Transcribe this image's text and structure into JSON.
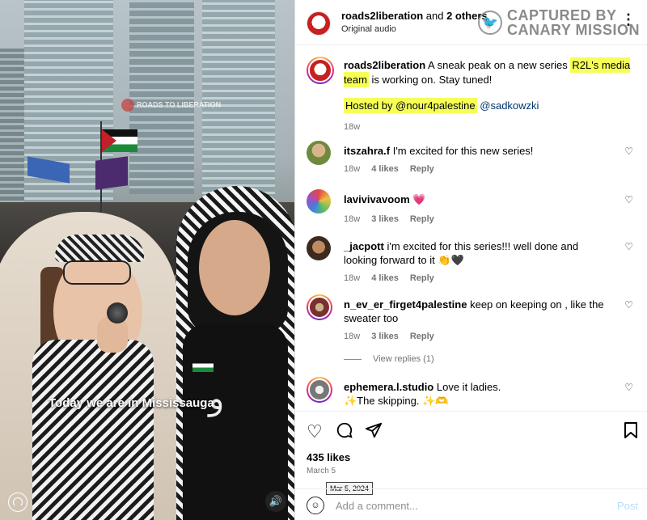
{
  "header": {
    "username": "roads2liberation",
    "and_text": " and ",
    "others": "2 others",
    "audio": "Original audio",
    "watermark_line1": "CAPTURED BY",
    "watermark_line2": "CANARY MISSION"
  },
  "video": {
    "watermark": "ROADS TO LIBERATION",
    "caption": "Today we are in Mississauga",
    "sound_icon": "speaker-icon"
  },
  "post_caption": {
    "username": "roads2liberation",
    "text_before": " A sneak peak on a new series ",
    "highlight_1": "R2L's media team",
    "text_after": " is working on. Stay tuned!",
    "hosted_by_highlight": "Hosted by @nour4palestine",
    "mention_2": "@sadkowzki",
    "time": "18w"
  },
  "comments": [
    {
      "username": "itszahra.f",
      "text": "I'm excited for this new series!",
      "time": "18w",
      "likes": "4 likes",
      "reply": "Reply"
    },
    {
      "username": "lavivivavoom",
      "text": "💗",
      "time": "18w",
      "likes": "3 likes",
      "reply": "Reply"
    },
    {
      "username": "_jacpott",
      "text": "i'm excited for this series!!! well done and looking forward to it 👏🖤",
      "time": "18w",
      "likes": "4 likes",
      "reply": "Reply"
    },
    {
      "username": "n_ev_er_firget4palestine",
      "text": "keep on keeping on , like the sweater too",
      "time": "18w",
      "likes": "3 likes",
      "reply": "Reply"
    },
    {
      "username": "ephemera.l.studio",
      "text": "Love it ladies.",
      "line2": "✨The skipping. ✨🫶"
    }
  ],
  "view_replies": "View replies (1)",
  "footer": {
    "likes": "435 likes",
    "date": "March 5",
    "tooltip": "Mar 5, 2024",
    "comment_placeholder": "Add a comment...",
    "post_label": "Post"
  },
  "colors": {
    "highlight": "#f6ff57",
    "link": "#00376b",
    "muted": "#737373"
  }
}
